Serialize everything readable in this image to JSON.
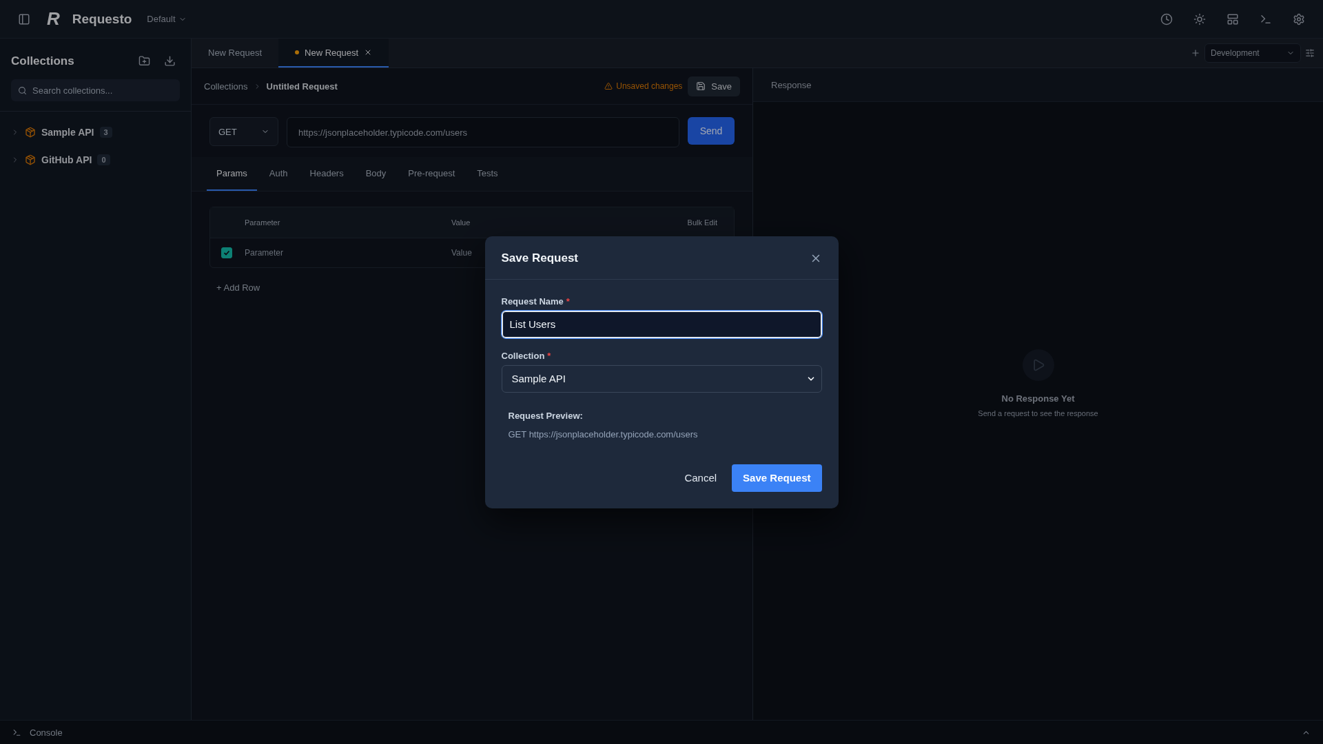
{
  "app": {
    "logo": "R",
    "name": "Requesto",
    "workspace": "Default"
  },
  "sidebar": {
    "title": "Collections",
    "search_placeholder": "Search collections...",
    "collections": [
      {
        "name": "Sample API",
        "count": "3"
      },
      {
        "name": "GitHub API",
        "count": "0"
      }
    ]
  },
  "tabs": [
    {
      "label": "New Request",
      "selected": false,
      "unsaved": false
    },
    {
      "label": "New Request",
      "selected": true,
      "unsaved": true
    }
  ],
  "environment": "Development",
  "request": {
    "breadcrumb_root": "Collections",
    "breadcrumb_current": "Untitled Request",
    "unsaved_label": "Unsaved changes",
    "save_label": "Save",
    "method": "GET",
    "url": "https://jsonplaceholder.typicode.com/users",
    "send_label": "Send",
    "tabs": [
      {
        "label": "Params",
        "selected": true
      },
      {
        "label": "Auth",
        "selected": false
      },
      {
        "label": "Headers",
        "selected": false
      },
      {
        "label": "Body",
        "selected": false
      },
      {
        "label": "Pre-request",
        "selected": false
      },
      {
        "label": "Tests",
        "selected": false
      }
    ],
    "params": {
      "column_key": "Parameter",
      "column_value": "Value",
      "bulk_edit": "Bulk Edit",
      "rows": [
        {
          "checked": true,
          "key_placeholder": "Parameter",
          "value_placeholder": "Value"
        }
      ],
      "add_row": "+ Add Row"
    }
  },
  "response": {
    "title": "Response",
    "empty_title": "No Response Yet",
    "empty_text": "Send a request to see the response"
  },
  "console": {
    "label": "Console"
  },
  "dialog": {
    "title": "Save Request",
    "name_label": "Request Name",
    "name_mark": "*",
    "name_value": "List Users",
    "collection_label": "Collection",
    "collection_mark": "*",
    "collection_value": "Sample API",
    "preview_label": "Request Preview:",
    "preview_method": "GET",
    "preview_url": "https://jsonplaceholder.typicode.com/users",
    "cancel_label": "Cancel",
    "save_label": "Save Request"
  }
}
